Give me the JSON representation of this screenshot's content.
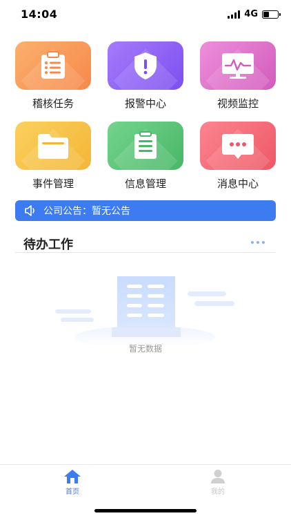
{
  "status_bar": {
    "time": "14:04",
    "network": "4G",
    "battery_level": 0.4
  },
  "menu": [
    {
      "label": "稽核任务",
      "icon": "clipboard-list-icon",
      "color": "#f89d5a"
    },
    {
      "label": "报警中心",
      "icon": "shield-alert-icon",
      "color": "#8e63f5"
    },
    {
      "label": "视频监控",
      "icon": "monitor-chart-icon",
      "color": "#e075c8"
    },
    {
      "label": "事件管理",
      "icon": "folder-icon",
      "color": "#f7c145"
    },
    {
      "label": "信息管理",
      "icon": "document-list-icon",
      "color": "#5cc478"
    },
    {
      "label": "消息中心",
      "icon": "chat-bubble-icon",
      "color": "#f26a78"
    }
  ],
  "notice": {
    "text": "公司公告：暂无公告",
    "icon": "speaker-icon",
    "color": "#3d7cf0"
  },
  "todo": {
    "title": "待办工作",
    "more_icon": "more-dots-icon",
    "empty_text": "暂无数据"
  },
  "tab_bar": {
    "items": [
      {
        "label": "首页",
        "icon": "home-icon",
        "active": true
      },
      {
        "label": "我的",
        "icon": "person-icon",
        "active": false
      }
    ],
    "active_color": "#3d7cf0",
    "inactive_color": "#c5c5c5"
  }
}
